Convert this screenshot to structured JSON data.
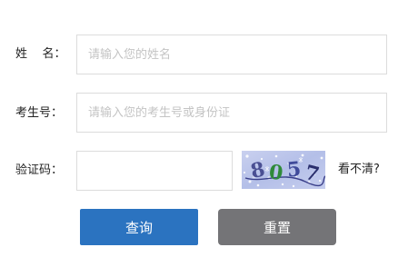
{
  "form": {
    "name_label": "姓    名：",
    "name_placeholder": "请输入您的姓名",
    "exam_no_label": "考生号：",
    "exam_no_placeholder": "请输入您的考生号或身份证",
    "captcha_label": "验证码：",
    "captcha_value": "",
    "captcha_chars": [
      "8",
      "0",
      "5",
      "7"
    ],
    "refresh_label": "看不清?"
  },
  "buttons": {
    "query_label": "查询",
    "reset_label": "重置"
  },
  "colors": {
    "query_button": "#2b73c0",
    "reset_button": "#747477",
    "captcha_bg": "#b9c3ea"
  }
}
